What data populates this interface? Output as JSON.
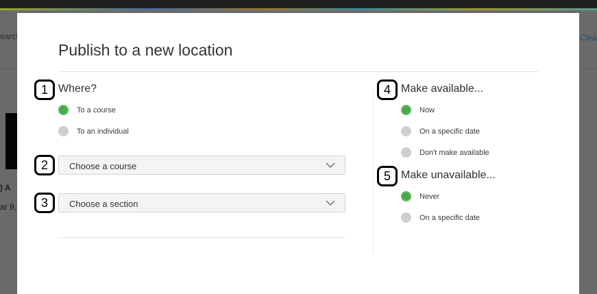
{
  "background": {
    "search_fragment": "earch",
    "clear_link": "Clea",
    "heading_fragment": ") A",
    "date_fragment": "ar 9,"
  },
  "modal": {
    "title": "Publish to a new location",
    "where": {
      "label": "Where?",
      "options": [
        {
          "label": "To a course",
          "selected": true
        },
        {
          "label": "To an individual",
          "selected": false
        }
      ]
    },
    "course_select": {
      "value": "Choose a course"
    },
    "section_select": {
      "value": "Choose a section"
    },
    "make_available": {
      "label": "Make available...",
      "options": [
        {
          "label": "Now",
          "selected": true
        },
        {
          "label": "On a specific date",
          "selected": false
        },
        {
          "label": "Don't make available",
          "selected": false
        }
      ]
    },
    "make_unavailable": {
      "label": "Make unavailable...",
      "options": [
        {
          "label": "Never",
          "selected": true
        },
        {
          "label": "On a specific date",
          "selected": false
        }
      ]
    }
  },
  "annotations": [
    "1",
    "2",
    "3",
    "4",
    "5"
  ],
  "colors": {
    "radio_selected": "#4aa84a",
    "radio_unselected": "#cfcfcf",
    "overlay": "#6a6a6a"
  }
}
